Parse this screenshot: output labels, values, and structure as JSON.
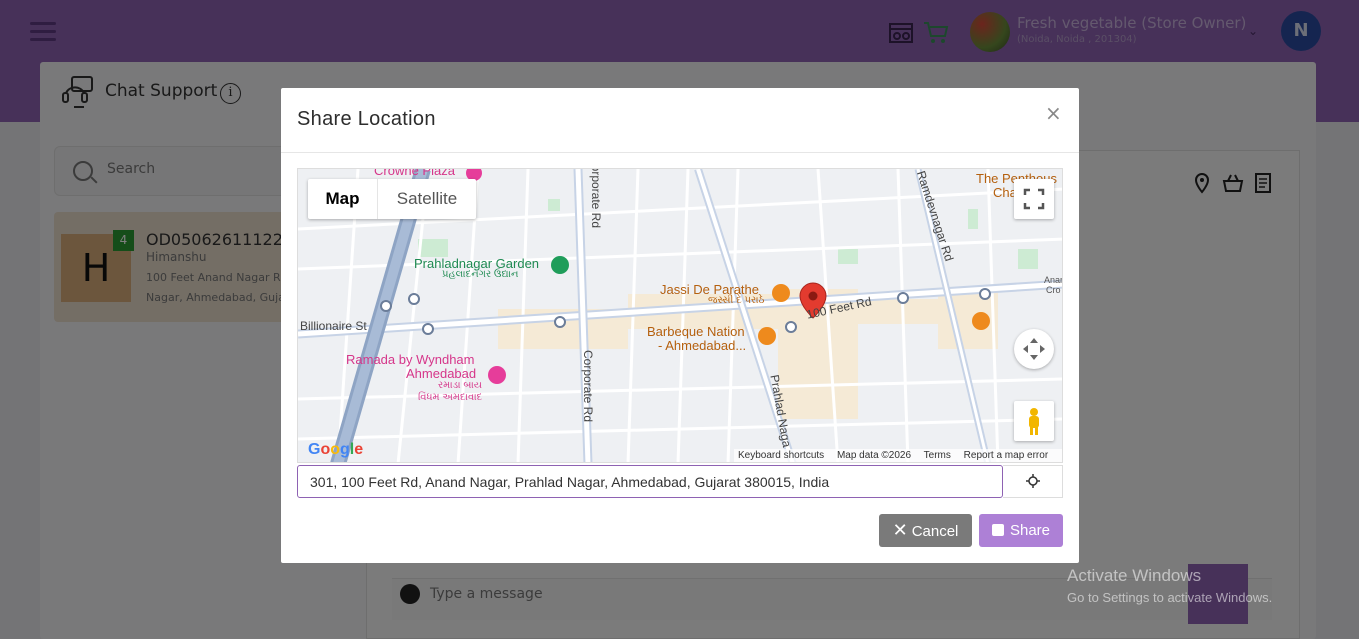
{
  "header": {
    "store_name": "Fresh vegetable (Store Owner)",
    "store_address": "(Noida, Noida , 201304)",
    "user_initial": "N"
  },
  "chat": {
    "title": "Chat Support",
    "search_placeholder": "Search",
    "conversation": {
      "initial": "H",
      "unread": "4",
      "order_id": "OD050626111220",
      "customer": "Himanshu",
      "address_line1": "100 Feet Anand Nagar Rd",
      "address_line2": "Nagar, Ahmedabad, Gujarat"
    },
    "message_placeholder": "Type a message"
  },
  "modal": {
    "title": "Share Location",
    "close": "×",
    "map": {
      "type_options": [
        "Map",
        "Satellite"
      ],
      "selected_type": "Map",
      "google": "Google",
      "attribution": [
        "Keyboard shortcuts",
        "Map data ©2026",
        "Terms",
        "Report a map error"
      ],
      "pois": {
        "crowne": "Crowne Plaza",
        "prahladnagar_garden": "Prahladnagar Garden",
        "prahladnagar_garden_gu": "પ્રહલાદનગર ઉદ્યાન",
        "jassi": "Jassi De Parathe",
        "jassi_gu": "જસ્સી દે પરાઠે",
        "barbeque_1": "Barbeque Nation",
        "barbeque_2": "- Ahmedabad...",
        "ramada_1": "Ramada by Wyndham",
        "ramada_2": "Ahmedabad",
        "ramada_gu_1": "રમાડા બાય",
        "ramada_gu_2": "વિંધમ અમદાવાદ",
        "penthouse_1": "The Penthous",
        "penthouse_2": "Cha",
        "anand_1": "Anan",
        "anand_2": "Cro"
      },
      "roads": {
        "billionaire": "Billionaire St",
        "corporate_top": "Corporate Rd",
        "corporate_bottom": "Corporate Rd",
        "feet100": "100 Feet Rd",
        "ramdevnagar": "Ramdevnagar Rd",
        "prahlad": "Prahlad Naga"
      }
    },
    "address_value": "301, 100 Feet Rd, Anand Nagar, Prahlad Nagar, Ahmedabad, Gujarat 380015, India",
    "cancel_label": "Cancel",
    "share_label": "Share"
  },
  "watermark": {
    "line1": "Activate Windows",
    "line2": "Go to Settings to activate Windows."
  },
  "colors": {
    "header": "#8e62b3",
    "accent": "#ad80d6",
    "cancel": "#7a7a7a",
    "badge": "#2b9a33"
  }
}
